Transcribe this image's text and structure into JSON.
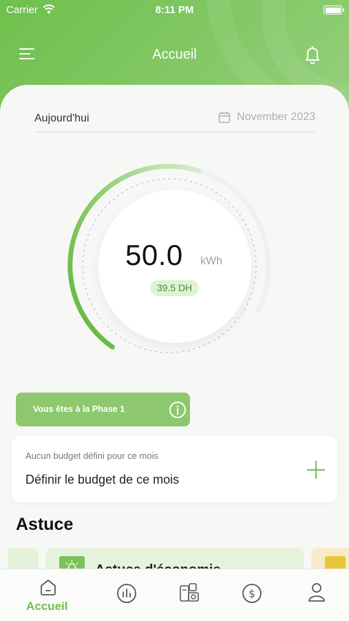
{
  "status_bar": {
    "carrier": "Carrier",
    "time": "8:11 PM"
  },
  "header": {
    "title": "Accueil"
  },
  "date_row": {
    "today_label": "Aujourd'hui",
    "month_label": "November 2023"
  },
  "consumption": {
    "value": "50.0",
    "unit": "kWh",
    "cost": "39.5 DH",
    "gauge_fraction": 0.62
  },
  "phase": {
    "label": "Vous êtes à la Phase  1"
  },
  "budget": {
    "subtitle": "Aucun budget défini pour ce mois",
    "title": "Définir le budget de ce mois"
  },
  "tips": {
    "section_title": "Astuce",
    "card_title": "Astuce d'économie"
  },
  "tabbar": {
    "active_label": "Accueil"
  },
  "colors": {
    "accent": "#6fc04c",
    "header_green": "#86c96a",
    "phase_green": "#8dc86e",
    "badge_bg": "#dff3d4",
    "tip_yellow": "#eac43b"
  },
  "icons": {
    "menu": "menu-icon",
    "bell": "bell-icon",
    "calendar": "calendar-icon",
    "info": "info-icon",
    "plus": "plus-icon",
    "home": "home-icon",
    "stats": "bar-chart-icon",
    "devices": "appliances-icon",
    "money": "dollar-icon",
    "profile": "user-icon"
  }
}
